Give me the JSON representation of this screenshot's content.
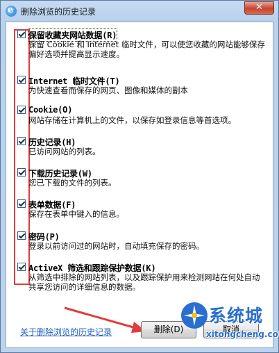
{
  "window": {
    "title": "删除浏览的历史记录",
    "close_glyph": "✕"
  },
  "options": [
    {
      "title": "保留收藏夹网站数据(R)",
      "description": "保留 Cookie 和 Internet 临时文件，可以使您收藏的网站能够保存偏好选项并提高显示速度。",
      "checked": true
    },
    {
      "title": "Internet 临时文件(T)",
      "description": "为快速查看而保存的网页、图像和媒体的副本",
      "checked": true
    },
    {
      "title": "Cookie(O)",
      "description": "网站存储在计算机上的文件，以保存如登录信息等首选项。",
      "checked": true
    },
    {
      "title": "历史记录(H)",
      "description": "已访问网站的列表。",
      "checked": true
    },
    {
      "title": "下载历史记录(W)",
      "description": "您已下载的文件的列表。",
      "checked": true
    },
    {
      "title": "表单数据(F)",
      "description": "保存在表单中键入的信息。",
      "checked": true
    },
    {
      "title": "密码(P)",
      "description": "登录以前访问过的网站时，自动填充保存的密码。",
      "checked": true
    },
    {
      "title": "ActiveX 筛选和跟踪保护数据(K)",
      "description": "从筛选中排除的网站列表，以及跟踪保护用来检测网站在何处自动共享您访问的详细信息的数据。",
      "checked": true
    }
  ],
  "footer": {
    "link": "关于删除浏览的历史记录",
    "delete_button": "删除(D)",
    "cancel_button": "取消"
  },
  "watermark": {
    "name": "系统城",
    "domain": "xitongcheng.com"
  },
  "colors": {
    "annotation_red": "#e23b3b",
    "link_blue": "#1f5fbf"
  }
}
